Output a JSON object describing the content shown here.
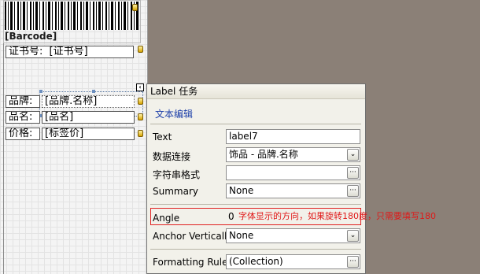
{
  "design_surface": {
    "barcode_label": "[Barcode]",
    "rows": [
      {
        "label": "证书号:",
        "value": "[证书号]"
      },
      {
        "label": "品牌:",
        "value": "[品牌.名称]"
      },
      {
        "label": "品名:",
        "value": "[品名]"
      },
      {
        "label": "价格:",
        "value": "[标签价]"
      }
    ],
    "smart_tag_glyph": "‹"
  },
  "task_panel": {
    "title": "Label 任务",
    "section": "文本编辑",
    "rows": [
      {
        "label": "Text",
        "value": "label7"
      },
      {
        "label": "数据连接",
        "value": "饰品 - 品牌.名称"
      },
      {
        "label": "字符串格式",
        "value": ""
      },
      {
        "label": "Summary",
        "value": "None"
      },
      {
        "label": "Angle",
        "value": "0"
      },
      {
        "label": "Anchor Vertically",
        "value": "None"
      },
      {
        "label": "Formatting Rules",
        "value": "(Collection)"
      }
    ],
    "dropdown_glyph": "⌄",
    "ellipsis_glyph": "···"
  },
  "annotation": {
    "text": "字体显示的方向，如果旋转180度，只需要填写180",
    "color": "#e01818"
  }
}
